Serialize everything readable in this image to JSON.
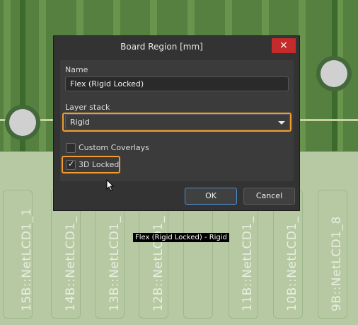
{
  "dialog": {
    "title": "Board Region [mm]",
    "close_icon": "×",
    "name_label": "Name",
    "name_value": "Flex (Rigid Locked)",
    "layer_stack_label": "Layer stack",
    "layer_stack_value": "Rigid",
    "custom_coverlays_label": "Custom Coverlays",
    "custom_coverlays_checked": false,
    "locked_3d_label": "3D Locked",
    "locked_3d_checked": true,
    "ok_label": "OK",
    "cancel_label": "Cancel"
  },
  "tooltip": {
    "text": "Flex (Rigid Locked) - Rigid"
  },
  "board": {
    "component_labels": [
      "15B::NetLCD1_1",
      "14B::NetLCD1_",
      "13B::NetLCD1_",
      "12B::NetLCD1_",
      "11B::NetLCD1_",
      "10B::NetLCD1_",
      "9B::NetLCD1_8"
    ]
  },
  "colors": {
    "accent_highlight": "#f39c2b",
    "close_button": "#c42b2b",
    "dialog_bg": "#333333"
  },
  "icons": {
    "close": "close-icon",
    "dropdown": "chevron-down-icon",
    "check": "check-icon",
    "cursor": "mouse-cursor-icon"
  }
}
